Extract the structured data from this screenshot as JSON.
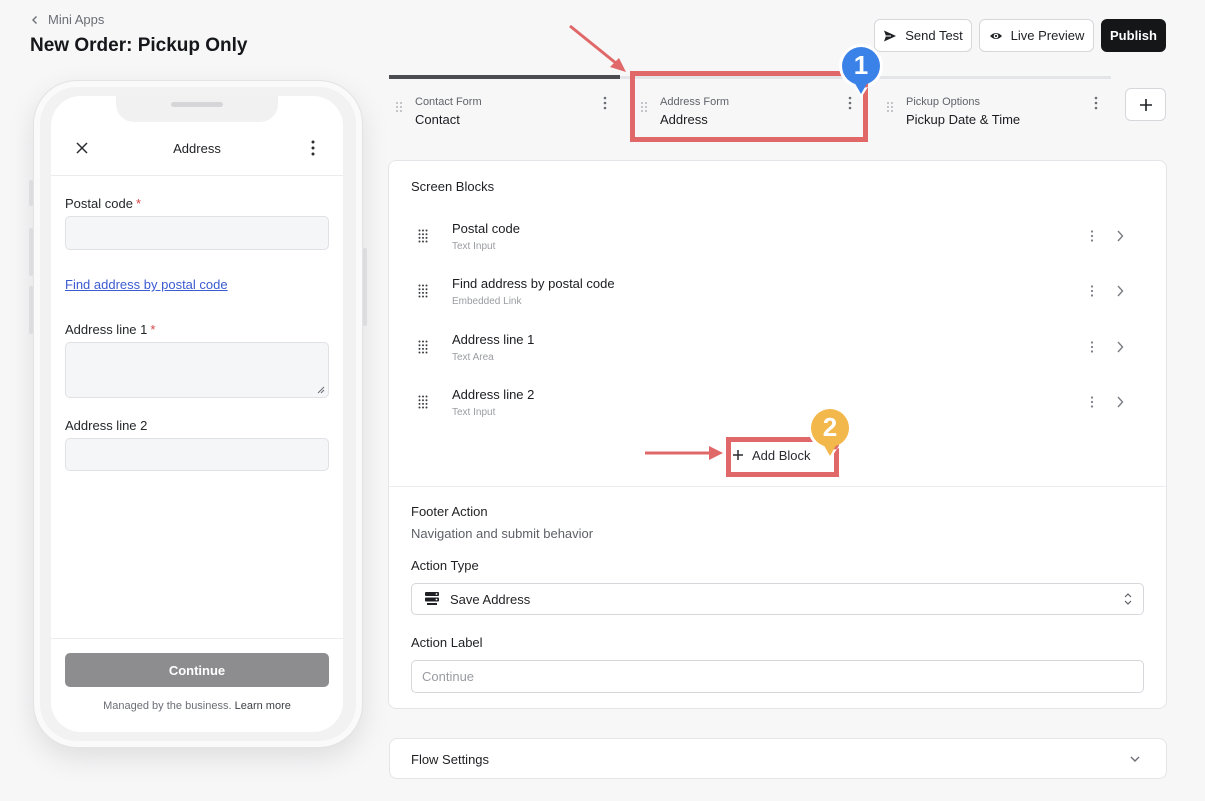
{
  "header": {
    "back_label": "Mini Apps",
    "title": "New Order: Pickup Only",
    "send_test_label": "Send Test",
    "live_preview_label": "Live Preview",
    "publish_label": "Publish"
  },
  "phone": {
    "screen_title": "Address",
    "fields": [
      {
        "label": "Postal code",
        "required": "*"
      },
      {
        "label": "Address line 1",
        "required": "*"
      },
      {
        "label": "Address line 2"
      }
    ],
    "link_text": "Find address by postal code",
    "continue_label": "Continue",
    "managed_text": "Managed by the business.",
    "learn_more": "Learn more"
  },
  "tabs": [
    {
      "kind": "Contact Form",
      "name": "Contact"
    },
    {
      "kind": "Address Form",
      "name": "Address"
    },
    {
      "kind": "Pickup Options",
      "name": "Pickup Date & Time"
    }
  ],
  "screen_blocks": {
    "title": "Screen Blocks",
    "items": [
      {
        "name": "Postal code",
        "type": "Text Input"
      },
      {
        "name": "Find address by postal code",
        "type": "Embedded Link"
      },
      {
        "name": "Address line 1",
        "type": "Text Area"
      },
      {
        "name": "Address line 2",
        "type": "Text Input"
      }
    ],
    "add_label": "Add Block"
  },
  "footer_action": {
    "title": "Footer Action",
    "subtitle": "Navigation and submit behavior",
    "action_type_label": "Action Type",
    "action_type_value": "Save Address",
    "action_label_label": "Action Label",
    "action_label_placeholder": "Continue"
  },
  "flow_settings": {
    "label": "Flow Settings"
  },
  "annotations": {
    "marker_1": "1",
    "marker_2": "2",
    "box_color": "#e06868",
    "marker_1_color": "#3b82e8",
    "marker_2_color": "#f2b84b"
  }
}
